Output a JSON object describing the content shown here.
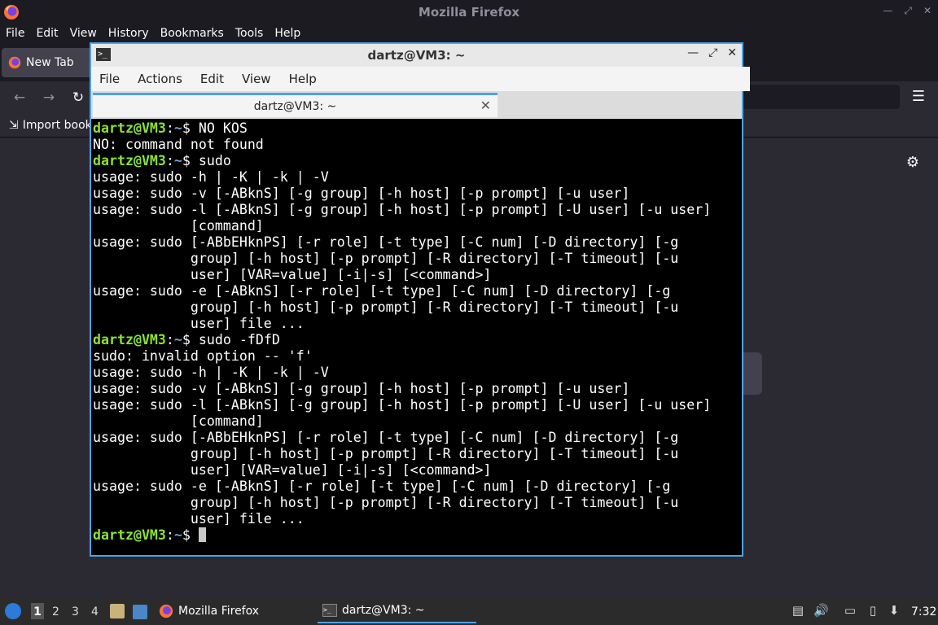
{
  "firefox": {
    "title": "Mozilla Firefox",
    "menu": [
      "File",
      "Edit",
      "View",
      "History",
      "Bookmarks",
      "Tools",
      "Help"
    ],
    "tab_label": "New Tab",
    "bookmark_label": "Import book"
  },
  "terminal": {
    "title": "dartz@VM3: ~",
    "menu": [
      "File",
      "Actions",
      "Edit",
      "View",
      "Help"
    ],
    "tab_label": "dartz@VM3: ~",
    "prompt_user": "dartz@VM3",
    "prompt_path": "~",
    "lines": [
      {
        "type": "cmd",
        "text": " NO KOS"
      },
      {
        "type": "out",
        "text": "NO: command not found"
      },
      {
        "type": "cmd",
        "text": " sudo"
      },
      {
        "type": "out",
        "text": "usage: sudo -h | -K | -k | -V"
      },
      {
        "type": "out",
        "text": "usage: sudo -v [-ABknS] [-g group] [-h host] [-p prompt] [-u user]"
      },
      {
        "type": "out",
        "text": "usage: sudo -l [-ABknS] [-g group] [-h host] [-p prompt] [-U user] [-u user]"
      },
      {
        "type": "out",
        "text": "            [command]"
      },
      {
        "type": "out",
        "text": "usage: sudo [-ABbEHknPS] [-r role] [-t type] [-C num] [-D directory] [-g"
      },
      {
        "type": "out",
        "text": "            group] [-h host] [-p prompt] [-R directory] [-T timeout] [-u"
      },
      {
        "type": "out",
        "text": "            user] [VAR=value] [-i|-s] [<command>]"
      },
      {
        "type": "out",
        "text": "usage: sudo -e [-ABknS] [-r role] [-t type] [-C num] [-D directory] [-g"
      },
      {
        "type": "out",
        "text": "            group] [-h host] [-p prompt] [-R directory] [-T timeout] [-u"
      },
      {
        "type": "out",
        "text": "            user] file ..."
      },
      {
        "type": "cmd",
        "text": " sudo -fDfD"
      },
      {
        "type": "out",
        "text": "sudo: invalid option -- 'f'"
      },
      {
        "type": "out",
        "text": "usage: sudo -h | -K | -k | -V"
      },
      {
        "type": "out",
        "text": "usage: sudo -v [-ABknS] [-g group] [-h host] [-p prompt] [-u user]"
      },
      {
        "type": "out",
        "text": "usage: sudo -l [-ABknS] [-g group] [-h host] [-p prompt] [-U user] [-u user]"
      },
      {
        "type": "out",
        "text": "            [command]"
      },
      {
        "type": "out",
        "text": "usage: sudo [-ABbEHknPS] [-r role] [-t type] [-C num] [-D directory] [-g"
      },
      {
        "type": "out",
        "text": "            group] [-h host] [-p prompt] [-R directory] [-T timeout] [-u"
      },
      {
        "type": "out",
        "text": "            user] [VAR=value] [-i|-s] [<command>]"
      },
      {
        "type": "out",
        "text": "usage: sudo -e [-ABknS] [-r role] [-t type] [-C num] [-D directory] [-g"
      },
      {
        "type": "out",
        "text": "            group] [-h host] [-p prompt] [-R directory] [-T timeout] [-u"
      },
      {
        "type": "out",
        "text": "            user] file ..."
      },
      {
        "type": "cmd",
        "text": " ",
        "cursor": true
      }
    ]
  },
  "taskbar": {
    "workspaces": [
      "1",
      "2",
      "3",
      "4"
    ],
    "tasks": [
      {
        "label": "Mozilla Firefox",
        "icon": "firefox-icon"
      },
      {
        "label": "dartz@VM3: ~",
        "icon": "terminal-icon"
      }
    ],
    "clock": "7:32"
  },
  "colors": {
    "prompt_user": "#8ae234",
    "prompt_path": "#729fcf",
    "accent": "#4da3e8"
  }
}
